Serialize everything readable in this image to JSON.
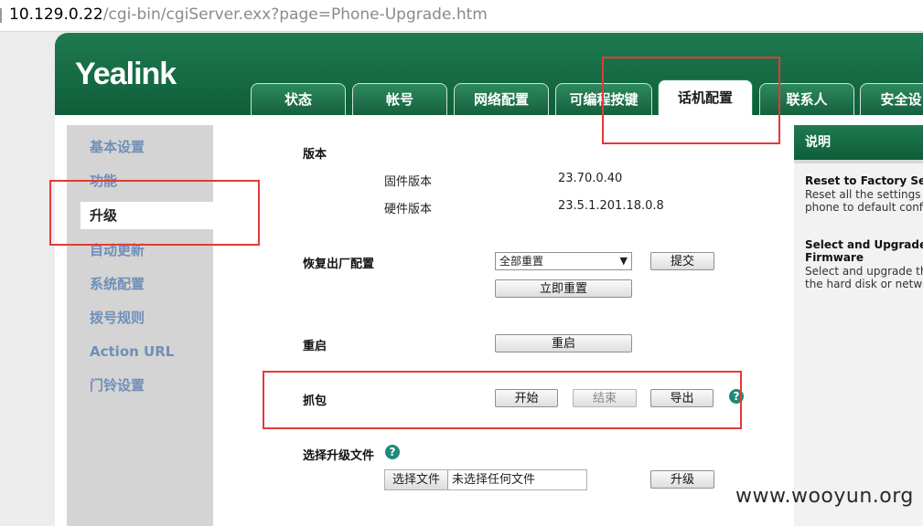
{
  "address_bar": {
    "host": "10.129.0.22",
    "path": "/cgi-bin/cgiServer.exx?page=Phone-Upgrade.htm"
  },
  "logo": "Yealink",
  "tabs": [
    {
      "label": "状态",
      "active": false
    },
    {
      "label": "帐号",
      "active": false
    },
    {
      "label": "网络配置",
      "active": false
    },
    {
      "label": "可编程按键",
      "active": false
    },
    {
      "label": "话机配置",
      "active": true
    },
    {
      "label": "联系人",
      "active": false
    },
    {
      "label": "安全设",
      "active": false
    }
  ],
  "sidebar": {
    "items": [
      {
        "label": "基本设置",
        "active": false
      },
      {
        "label": "功能",
        "active": false
      },
      {
        "label": "升级",
        "active": true
      },
      {
        "label": "自动更新",
        "active": false
      },
      {
        "label": "系统配置",
        "active": false
      },
      {
        "label": "拨号规则",
        "active": false
      },
      {
        "label": "Action URL",
        "active": false
      },
      {
        "label": "门铃设置",
        "active": false
      }
    ]
  },
  "main": {
    "version": {
      "label": "版本",
      "firmware_label": "固件版本",
      "firmware_value": "23.70.0.40",
      "hardware_label": "硬件版本",
      "hardware_value": "23.5.1.201.18.0.8"
    },
    "factory_reset": {
      "label": "恢复出厂配置",
      "select_value": "全部重置",
      "submit_label": "提交",
      "reset_now_label": "立即重置"
    },
    "reboot": {
      "label": "重启",
      "button_label": "重启"
    },
    "capture": {
      "label": "抓包",
      "start_label": "开始",
      "stop_label": "结束",
      "export_label": "导出",
      "help": "?"
    },
    "upgrade_file": {
      "label": "选择升级文件",
      "help": "?",
      "choose_label": "选择文件",
      "no_file_text": "未选择任何文件",
      "upgrade_label": "升级"
    }
  },
  "help_panel": {
    "title": "说明",
    "reset_heading": "Reset to Factory Setti",
    "reset_text_1": "Reset all the settings of",
    "reset_text_2": "phone to default config",
    "upgrade_heading_1": "Select and Upgrade",
    "upgrade_heading_2": "Firmware",
    "upgrade_text_1": "Select and upgrade the",
    "upgrade_text_2": "the hard disk or network"
  },
  "watermark": "www.wooyun.org",
  "colors": {
    "brand_green": "#0e5e3a",
    "link_blue": "#6f8fb8",
    "highlight_red": "#e53935",
    "help_teal": "#1d8a7a"
  }
}
